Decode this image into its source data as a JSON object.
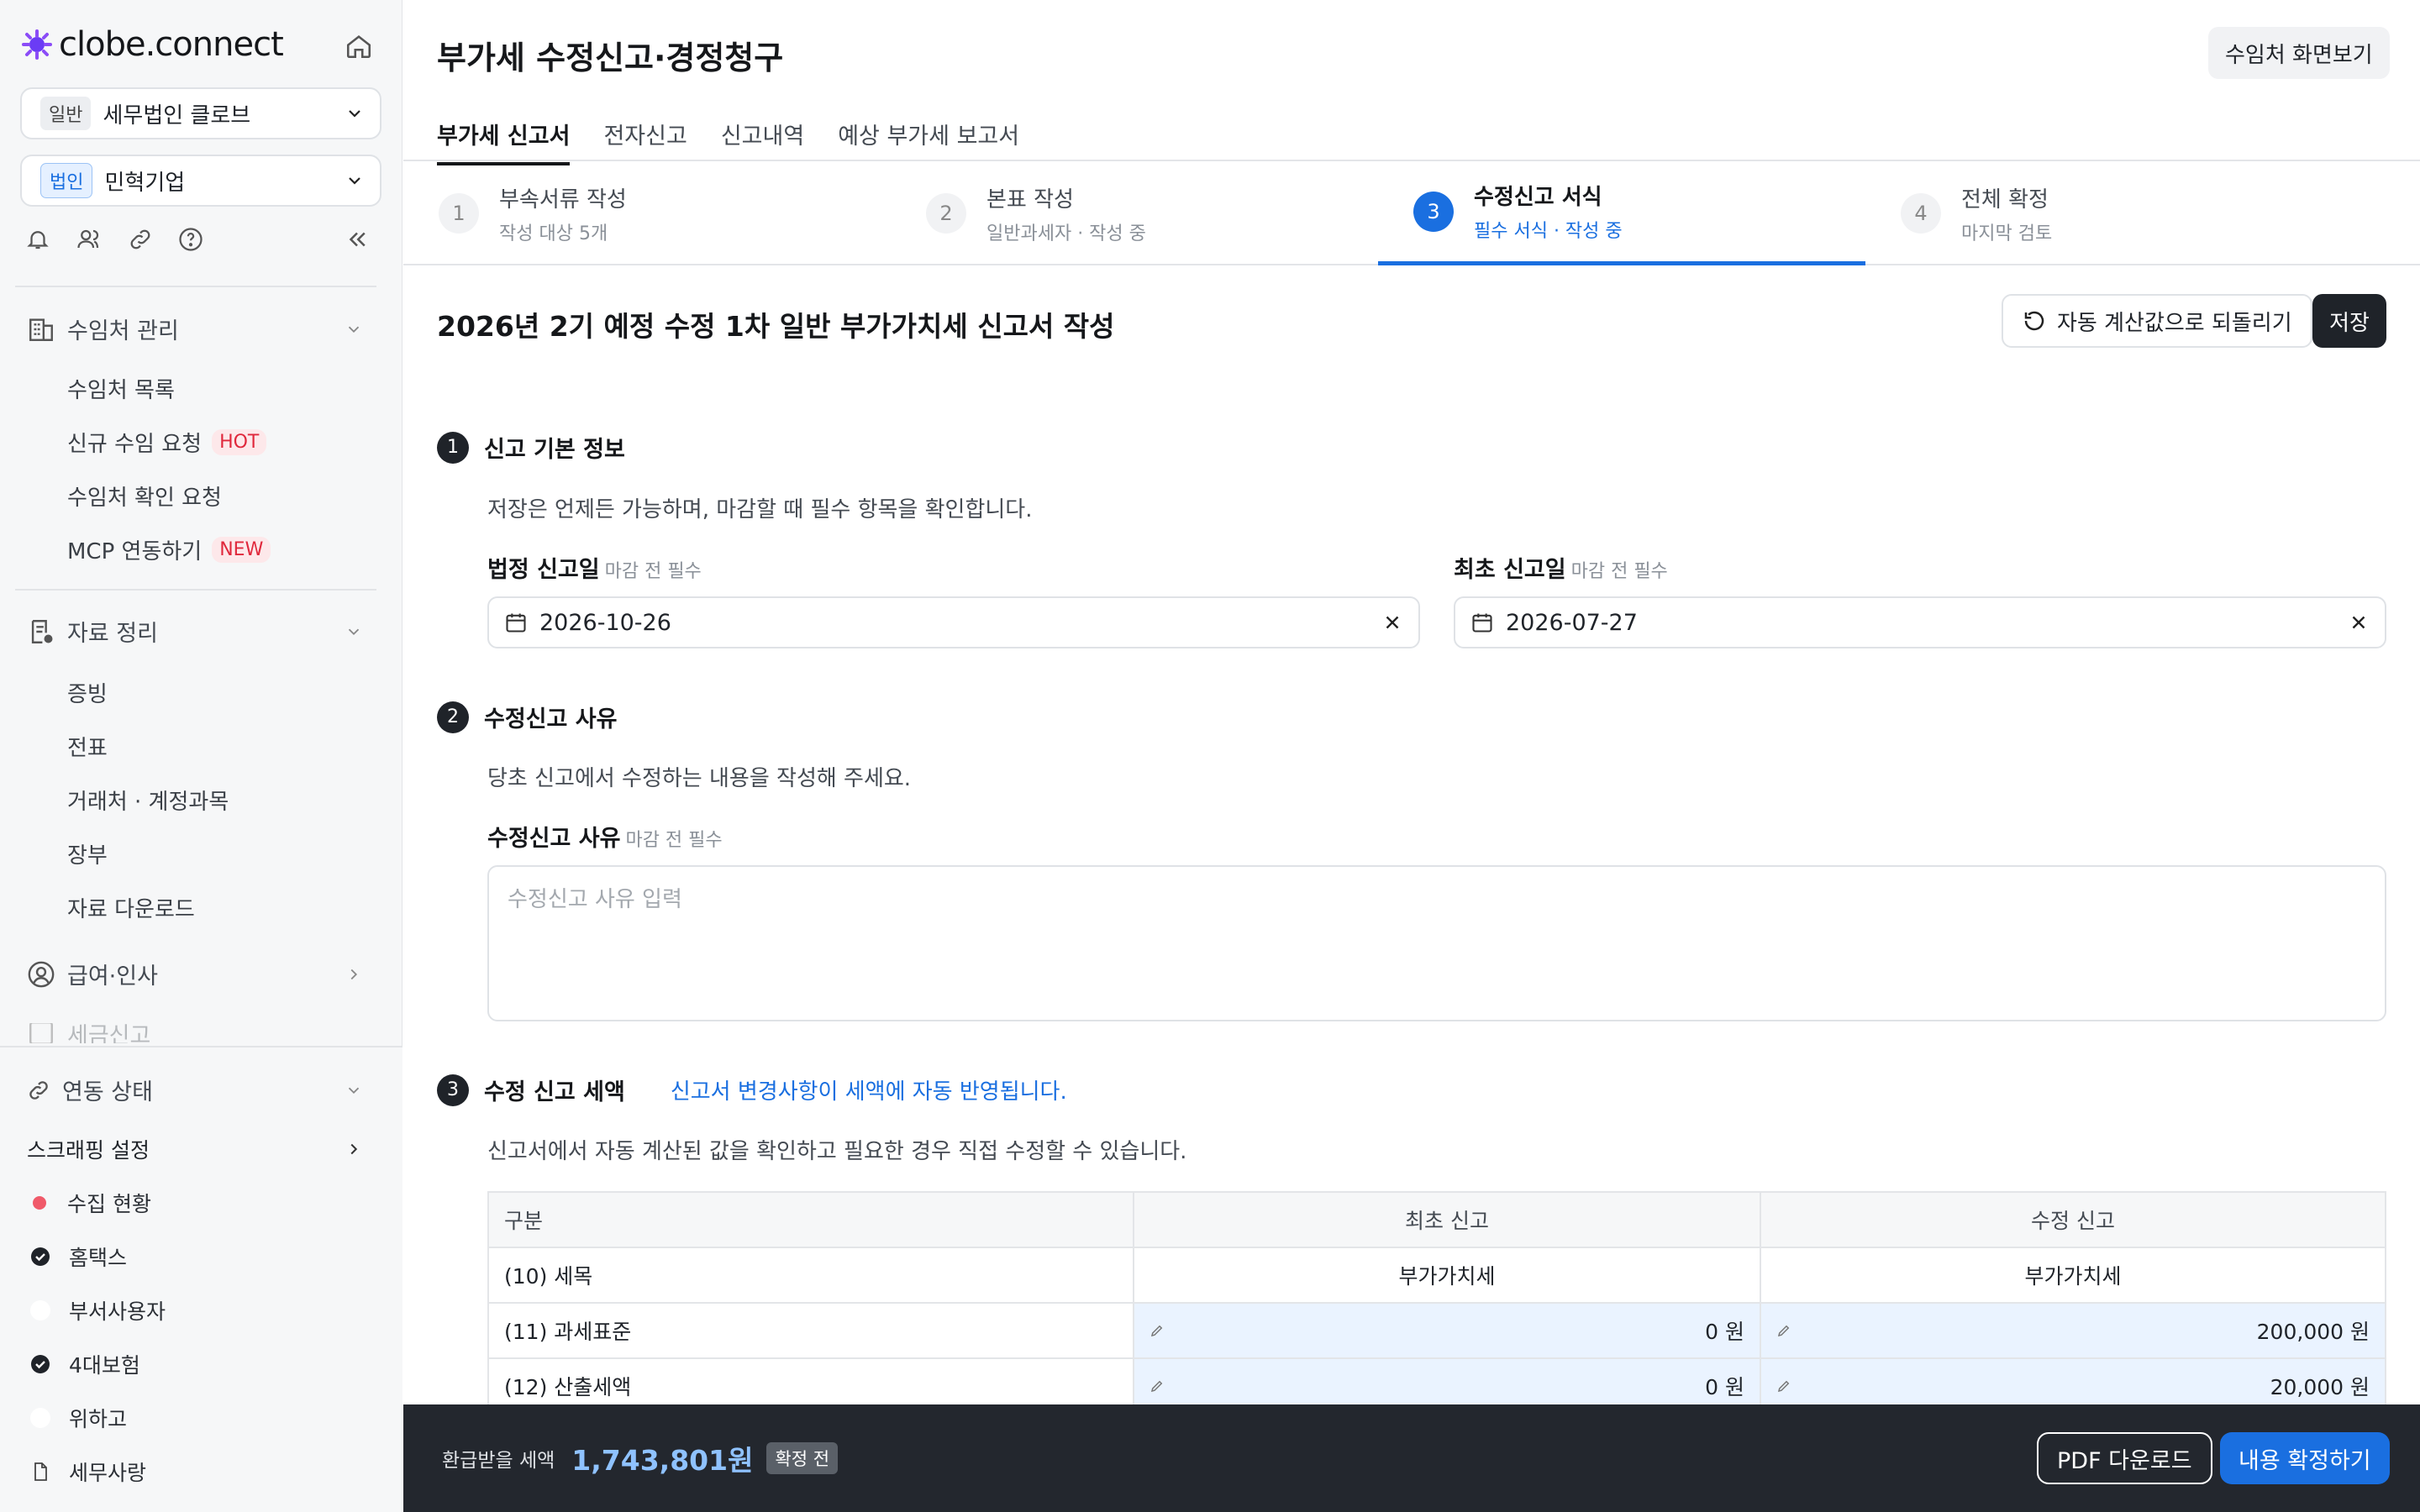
{
  "sidebar": {
    "logo": "clobe.connect",
    "company_tag": "일반",
    "company_name": "세무법인 클로브",
    "client_tag": "법인",
    "client_name": "민혁기업",
    "sections": [
      {
        "label": "수임처 관리",
        "items": [
          "수임처 목록",
          "신규 수임 요청",
          "수임처 확인 요청",
          "MCP 연동하기"
        ]
      },
      {
        "label": "자료 정리",
        "items": [
          "증빙",
          "전표",
          "거래처 · 계정과목",
          "장부",
          "자료 다운로드"
        ]
      },
      {
        "label": "급여·인사"
      },
      {
        "label": "세금신고"
      }
    ],
    "badges": {
      "hot": "HOT",
      "new": "NEW"
    },
    "integration": {
      "title": "연동 상태",
      "scraping": "스크래핑 설정",
      "items": [
        {
          "label": "수집 현황",
          "status": "error"
        },
        {
          "label": "홈택스",
          "status": "done"
        },
        {
          "label": "부서사용자",
          "status": "none"
        },
        {
          "label": "4대보험",
          "status": "done"
        },
        {
          "label": "위하고",
          "status": "none"
        },
        {
          "label": "세무사랑",
          "status": "file"
        }
      ]
    }
  },
  "header": {
    "title": "부가세 수정신고·경정청구",
    "view_client_button": "수임처 화면보기",
    "tabs": [
      "부가세 신고서",
      "전자신고",
      "신고내역",
      "예상 부가세 보고서"
    ]
  },
  "steps": [
    {
      "num": "1",
      "title": "부속서류 작성",
      "sub": "작성 대상 5개"
    },
    {
      "num": "2",
      "title": "본표 작성",
      "sub": "일반과세자 · 작성 중"
    },
    {
      "num": "3",
      "title": "수정신고 서식",
      "sub": "필수 서식 · 작성 중"
    },
    {
      "num": "4",
      "title": "전체 확정",
      "sub": "마지막 검토"
    }
  ],
  "form": {
    "title": "2026년 2기 예정 수정 1차 일반 부가가치세 신고서 작성",
    "reset_button": "자동 계산값으로 되돌리기",
    "save_button": "저장",
    "sec1": {
      "num": "1",
      "title": "신고 기본 정보",
      "desc": "저장은 언제든 가능하며, 마감할 때 필수 항목을 확인합니다.",
      "legal_label": "법정 신고일",
      "legal_hint": "마감 전 필수",
      "legal_value": "2026-10-26",
      "first_label": "최초 신고일",
      "first_hint": "마감 전 필수",
      "first_value": "2026-07-27"
    },
    "sec2": {
      "num": "2",
      "title": "수정신고 사유",
      "desc": "당초 신고에서 수정하는 내용을 작성해 주세요.",
      "label": "수정신고 사유",
      "hint": "마감 전 필수",
      "placeholder": "수정신고 사유 입력"
    },
    "sec3": {
      "num": "3",
      "title": "수정 신고 세액",
      "note": "신고서 변경사항이 세액에 자동 반영됩니다.",
      "desc": "신고서에서 자동 계산된 값을 확인하고 필요한 경우 직접 수정할 수 있습니다."
    }
  },
  "table": {
    "headers": [
      "구분",
      "최초 신고",
      "수정 신고"
    ],
    "rows": [
      {
        "label": "(10) 세목",
        "first": "부가가치세",
        "revised": "부가가치세"
      },
      {
        "label": "(11) 과세표준",
        "first": "0 원",
        "revised": "200,000 원"
      },
      {
        "label": "(12) 산출세액",
        "first": "0 원",
        "revised": "20,000 원"
      }
    ]
  },
  "bottom": {
    "refund_label": "환급받을 세액",
    "refund_amount": "1,743,801원",
    "refund_status": "확정 전",
    "pdf_button": "PDF 다운로드",
    "confirm_button": "내용 확정하기"
  },
  "colors": {
    "accent": "#1a6fe0",
    "dark": "#1f2329",
    "refund": "#8fc2ff"
  }
}
